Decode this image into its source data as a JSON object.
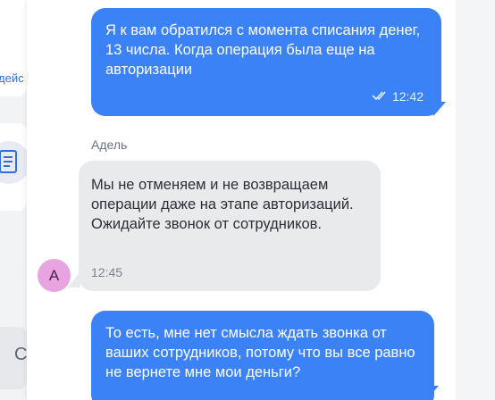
{
  "background_page": {
    "link_fragment": "дейс",
    "bottom_glyph": "С"
  },
  "chat": {
    "messages": [
      {
        "direction": "outgoing",
        "text": "Я к вам обратился с момента списания денег, 13 числа. Когда операция была еще на авторизации",
        "time": "12:42",
        "status": "read"
      },
      {
        "direction": "incoming",
        "sender": "Адель",
        "avatar_letter": "А",
        "text": "Мы не отменяем и не возвращаем операции даже на этапе авторизаций. Ожидайте звонок от сотрудников.",
        "time": "12:45"
      },
      {
        "direction": "outgoing",
        "text": "То есть, мне нет смысла ждать звонка от ваших сотрудников, потому что вы все равно не вернете мне мои деньги?"
      }
    ]
  },
  "colors": {
    "outgoing_bubble": "#3b82f6",
    "incoming_bubble": "#e9eaec",
    "avatar": "#e7a4e0"
  }
}
